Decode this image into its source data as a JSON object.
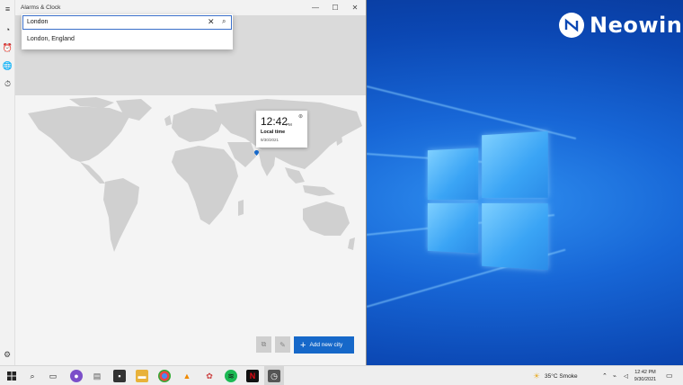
{
  "window": {
    "title": "Alarms & Clock",
    "minimize": "—",
    "maximize": "☐",
    "close": "✕"
  },
  "rail": [
    "≡",
    "◔",
    "⏰",
    "🌐",
    "⏱"
  ],
  "search": {
    "value": "London",
    "clear": "✕",
    "submit": "⌕",
    "suggestions": [
      "London, England"
    ]
  },
  "tooltip": {
    "time": "12:42",
    "ampm": "PM",
    "label": "Local time",
    "date": "9/30/2021"
  },
  "actions": {
    "compare": "⧉",
    "edit": "✎",
    "add_plus": "+",
    "add_label": "Add new city",
    "settings": "⚙"
  },
  "desktop": {
    "brand": "Neowin"
  },
  "taskbar": {
    "weather": "35°C  Smoke",
    "time": "12:42 PM",
    "date": "9/30/2021",
    "icons": [
      "start-icon",
      "search-icon",
      "task-view-icon",
      "firefox-icon",
      "photos-icon",
      "store-icon",
      "file-explorer-icon",
      "chrome-icon",
      "vlc-icon",
      "paint-icon",
      "spotify-icon",
      "netflix-icon",
      "alarms-icon"
    ]
  },
  "colors": {
    "accent": "#1668c9",
    "app_bg": "#f2f2f2",
    "map_land": "#d0d0d0"
  }
}
